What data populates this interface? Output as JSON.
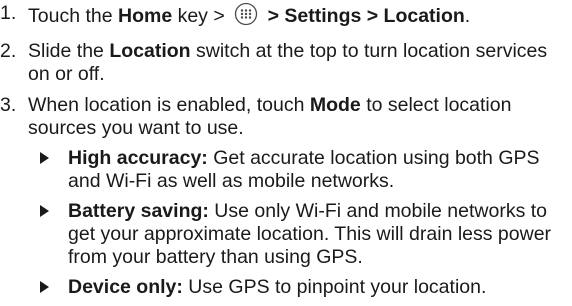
{
  "steps": [
    {
      "num": "1.",
      "parts": {
        "a": "Touch the ",
        "b": "Home",
        "c": " key > ",
        "d": " > Settings > Location",
        "e": "."
      },
      "icon": "apps-launcher-icon"
    },
    {
      "num": "2.",
      "parts": {
        "a": "Slide the ",
        "b": "Location",
        "c": " switch at the top to turn location services on or off."
      }
    },
    {
      "num": "3.",
      "parts": {
        "a": "When location is enabled, touch ",
        "b": "Mode",
        "c": " to select location sources you want to use."
      },
      "bullets": [
        {
          "term": "High accuracy:",
          "text": " Get accurate location using both GPS and Wi-Fi as well as mobile networks."
        },
        {
          "term": "Battery saving:",
          "text": " Use only Wi-Fi and mobile networks to get your approximate location. This will drain less power from your battery than using GPS."
        },
        {
          "term": "Device only:",
          "text": " Use GPS to pinpoint your location."
        }
      ]
    }
  ]
}
